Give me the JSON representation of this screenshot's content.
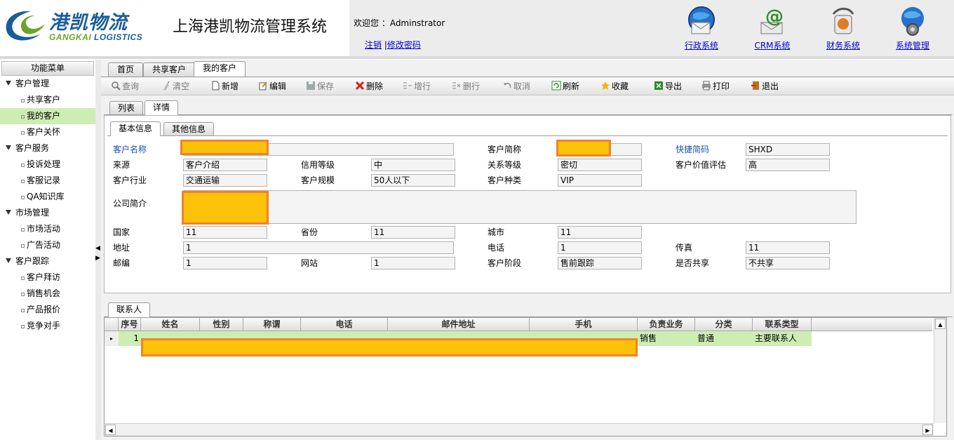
{
  "header": {
    "logo_cn": "港凯物流",
    "logo_en_a": "GANGKAI",
    "logo_en_b": " LOGISTICS",
    "system_title": "上海港凯物流管理系统",
    "welcome": "欢迎您 ：Adminstrator",
    "logout": "注销",
    "separator": "|",
    "change_password": "修改密码",
    "systems": [
      {
        "label": "行政系统",
        "icon": "mail-globe-icon"
      },
      {
        "label": "CRM系统",
        "icon": "email-at-icon"
      },
      {
        "label": "财务系统",
        "icon": "finance-icon"
      },
      {
        "label": "系统管理",
        "icon": "gear-globe-icon"
      }
    ]
  },
  "sidebar": {
    "title": "功能菜单",
    "groups": [
      {
        "label": "客户管理",
        "items": [
          "共享客户",
          "我的客户",
          "客户关怀"
        ]
      },
      {
        "label": "客户服务",
        "items": [
          "投诉处理",
          "客服记录",
          "QA知识库"
        ]
      },
      {
        "label": "市场管理",
        "items": [
          "市场活动",
          "广告活动"
        ]
      },
      {
        "label": "客户跟踪",
        "items": [
          "客户拜访",
          "销售机会",
          "产品报价",
          "竞争对手"
        ]
      }
    ]
  },
  "page_tabs": [
    "首页",
    "共享客户",
    "我的客户"
  ],
  "toolbar": [
    "查询",
    "清空",
    "新增",
    "编辑",
    "保存",
    "删除",
    "增行",
    "删行",
    "取消",
    "刷新",
    "收藏",
    "导出",
    "打印",
    "退出"
  ],
  "view_tabs": [
    "列表",
    "详情"
  ],
  "info_tabs": [
    "基本信息",
    "其他信息"
  ],
  "form": {
    "customer_name_label": "客户名称",
    "customer_short_label": "客户简称",
    "quick_code_label": "快捷简码",
    "quick_code": "SHXD",
    "source_label": "来源",
    "source": "客户介绍",
    "credit_label": "信用等级",
    "credit": "中",
    "relation_label": "关系等级",
    "relation": "密切",
    "value_label": "客户价值评估",
    "value": "高",
    "industry_label": "客户行业",
    "industry": "交通运输",
    "scale_label": "客户规模",
    "scale": "50人以下",
    "kind_label": "客户种类",
    "kind": "VIP",
    "intro_label": "公司简介",
    "country_label": "国家",
    "country": "11",
    "province_label": "省份",
    "province": "11",
    "city_label": "城市",
    "city": "11",
    "address_label": "地址",
    "address": "1",
    "phone_label": "电话",
    "phone": "1",
    "fax_label": "传真",
    "fax": "11",
    "zip_label": "邮编",
    "zip": "1",
    "website_label": "网站",
    "website": "1",
    "stage_label": "客户阶段",
    "stage": "售前跟踪",
    "shared_label": "是否共享",
    "shared": "不共享"
  },
  "contact_tab": "联系人",
  "contact_grid": {
    "headers": [
      "序号",
      "姓名",
      "性别",
      "称谓",
      "电话",
      "邮件地址",
      "手机",
      "负责业务",
      "分类",
      "联系类型"
    ],
    "row": {
      "index": "1",
      "business": "销售",
      "category": "普通",
      "contact_type": "主要联系人"
    }
  },
  "colors": {
    "redact_fill": "#fcc20a",
    "redact_border": "#f0822a",
    "selected_green": "#cdeeb3",
    "link_blue": "#0000cc"
  }
}
